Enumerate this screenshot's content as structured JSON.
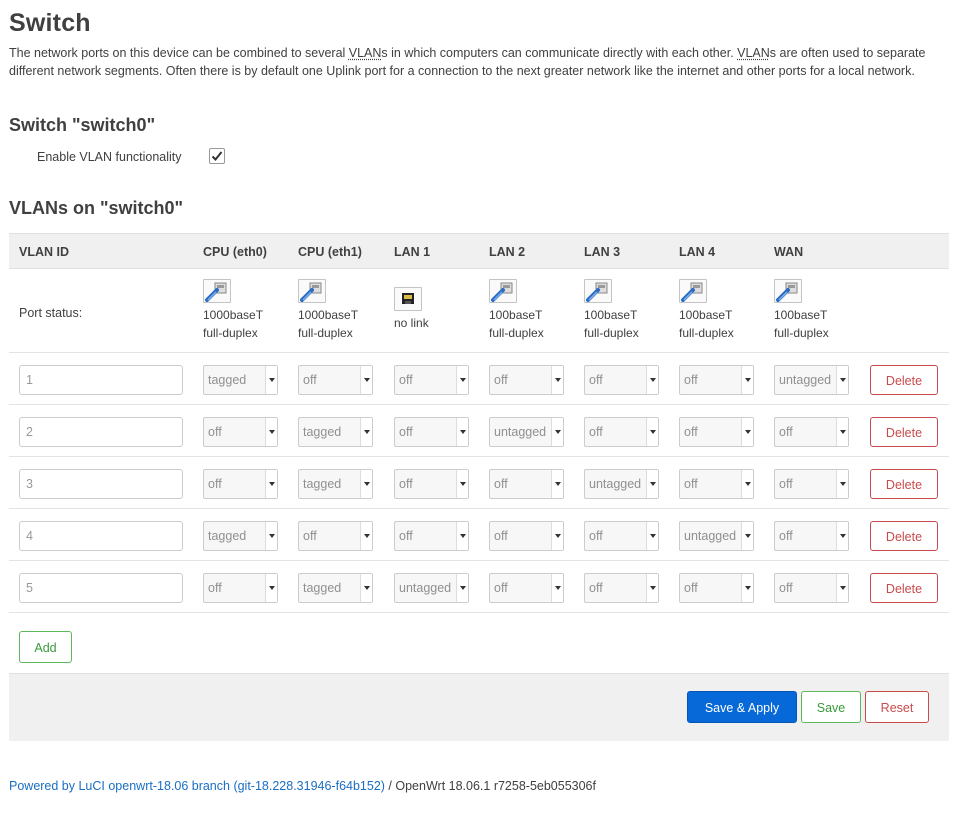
{
  "page": {
    "title": "Switch",
    "description_parts": [
      "The network ports on this device can be combined to several ",
      "VLAN",
      "s in which computers can communicate directly with each other. ",
      "VLAN",
      "s are often used to separate different network segments. Often there is by default one Uplink port for a connection to the next greater network like the internet and other ports for a local network."
    ]
  },
  "switch_section": {
    "title": "Switch \"switch0\"",
    "enable_vlan_label": "Enable VLAN functionality",
    "enable_vlan_checked": true
  },
  "vlans_section": {
    "title": "VLANs on \"switch0\"",
    "columns": [
      "VLAN ID",
      "CPU (eth0)",
      "CPU (eth1)",
      "LAN 1",
      "LAN 2",
      "LAN 3",
      "LAN 4",
      "WAN"
    ],
    "port_status_label": "Port status:",
    "port_status": [
      {
        "speed": "1000baseT",
        "duplex": "full-duplex",
        "icon": "ethernet-connected-icon"
      },
      {
        "speed": "1000baseT",
        "duplex": "full-duplex",
        "icon": "ethernet-connected-icon"
      },
      {
        "speed": "no link",
        "duplex": "",
        "icon": "ethernet-disconnected-icon"
      },
      {
        "speed": "100baseT",
        "duplex": "full-duplex",
        "icon": "ethernet-connected-icon"
      },
      {
        "speed": "100baseT",
        "duplex": "full-duplex",
        "icon": "ethernet-connected-icon"
      },
      {
        "speed": "100baseT",
        "duplex": "full-duplex",
        "icon": "ethernet-connected-icon"
      },
      {
        "speed": "100baseT",
        "duplex": "full-duplex",
        "icon": "ethernet-connected-icon"
      }
    ],
    "rows": [
      {
        "id": "1",
        "ports": [
          "tagged",
          "off",
          "off",
          "off",
          "off",
          "off",
          "untagged"
        ]
      },
      {
        "id": "2",
        "ports": [
          "off",
          "tagged",
          "off",
          "untagged",
          "off",
          "off",
          "off"
        ]
      },
      {
        "id": "3",
        "ports": [
          "off",
          "tagged",
          "off",
          "off",
          "untagged",
          "off",
          "off"
        ]
      },
      {
        "id": "4",
        "ports": [
          "tagged",
          "off",
          "off",
          "off",
          "off",
          "untagged",
          "off"
        ]
      },
      {
        "id": "5",
        "ports": [
          "off",
          "tagged",
          "untagged",
          "off",
          "off",
          "off",
          "off"
        ]
      }
    ],
    "delete_label": "Delete",
    "add_label": "Add"
  },
  "actions": {
    "save_apply_label": "Save & Apply",
    "save_label": "Save",
    "reset_label": "Reset"
  },
  "footer": {
    "powered_link": "Powered by LuCI openwrt-18.06 branch (git-18.228.31946-f64b152)",
    "separator": " / ",
    "version": "OpenWrt 18.06.1 r7258-5eb055306f"
  },
  "colors": {
    "primary": "#0769d8",
    "positive": "#5cb85c",
    "negative": "#c94c4c",
    "link": "#1a6ec4"
  }
}
